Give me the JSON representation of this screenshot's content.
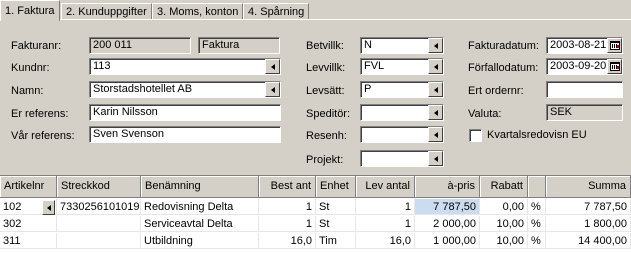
{
  "tabs": [
    "1. Faktura",
    "2. Kunduppgifter",
    "3. Moms, konton",
    "4. Spårning"
  ],
  "form": {
    "fakturanr_label": "Fakturanr:",
    "fakturanr_value": "200 011",
    "fakturatyp_value": "Faktura",
    "kundnr_label": "Kundnr:",
    "kundnr_value": "113",
    "namn_label": "Namn:",
    "namn_value": "Storstadshotellet AB",
    "er_ref_label": "Er referens:",
    "er_ref_value": "Karin Nilsson",
    "var_ref_label": "Vår referens:",
    "var_ref_value": "Sven Svenson",
    "betvillk_label": "Betvillk:",
    "betvillk_value": "N",
    "levvillk_label": "Levvillk:",
    "levvillk_value": "FVL",
    "levsatt_label": "Levsätt:",
    "levsatt_value": "P",
    "speditor_label": "Speditör:",
    "speditor_value": "",
    "resenh_label": "Resenh:",
    "resenh_value": "",
    "projekt_label": "Projekt:",
    "projekt_value": "",
    "fakturadatum_label": "Fakturadatum:",
    "fakturadatum_value": "2003-08-21",
    "forfallodatum_label": "Förfallodatum:",
    "forfallodatum_value": "2003-09-20",
    "ert_ordernr_label": "Ert ordernr:",
    "ert_ordernr_value": "",
    "valuta_label": "Valuta:",
    "valuta_value": "SEK",
    "kvartal_label": "Kvartalsredovisn EU",
    "kvartal_checked": false
  },
  "grid": {
    "headers": [
      "Artikelnr",
      "Streckkod",
      "Benämning",
      "Best ant",
      "Enhet",
      "Lev antal",
      "à-pris",
      "Rabatt",
      "",
      "Summa"
    ],
    "rows": [
      [
        "102",
        "7330256101019",
        "Redovisning Delta",
        "1",
        "St",
        "1",
        "7 787,50",
        "0,00",
        "%",
        "7 787,50"
      ],
      [
        "302",
        "",
        "Serviceavtal Delta",
        "1",
        "St",
        "1",
        "2 000,00",
        "10,00",
        "%",
        "1 800,00"
      ],
      [
        "311",
        "",
        "Utbildning",
        "16,0",
        "Tim",
        "16,0",
        "1 000,00",
        "10,00",
        "%",
        "14 400,00"
      ]
    ]
  }
}
